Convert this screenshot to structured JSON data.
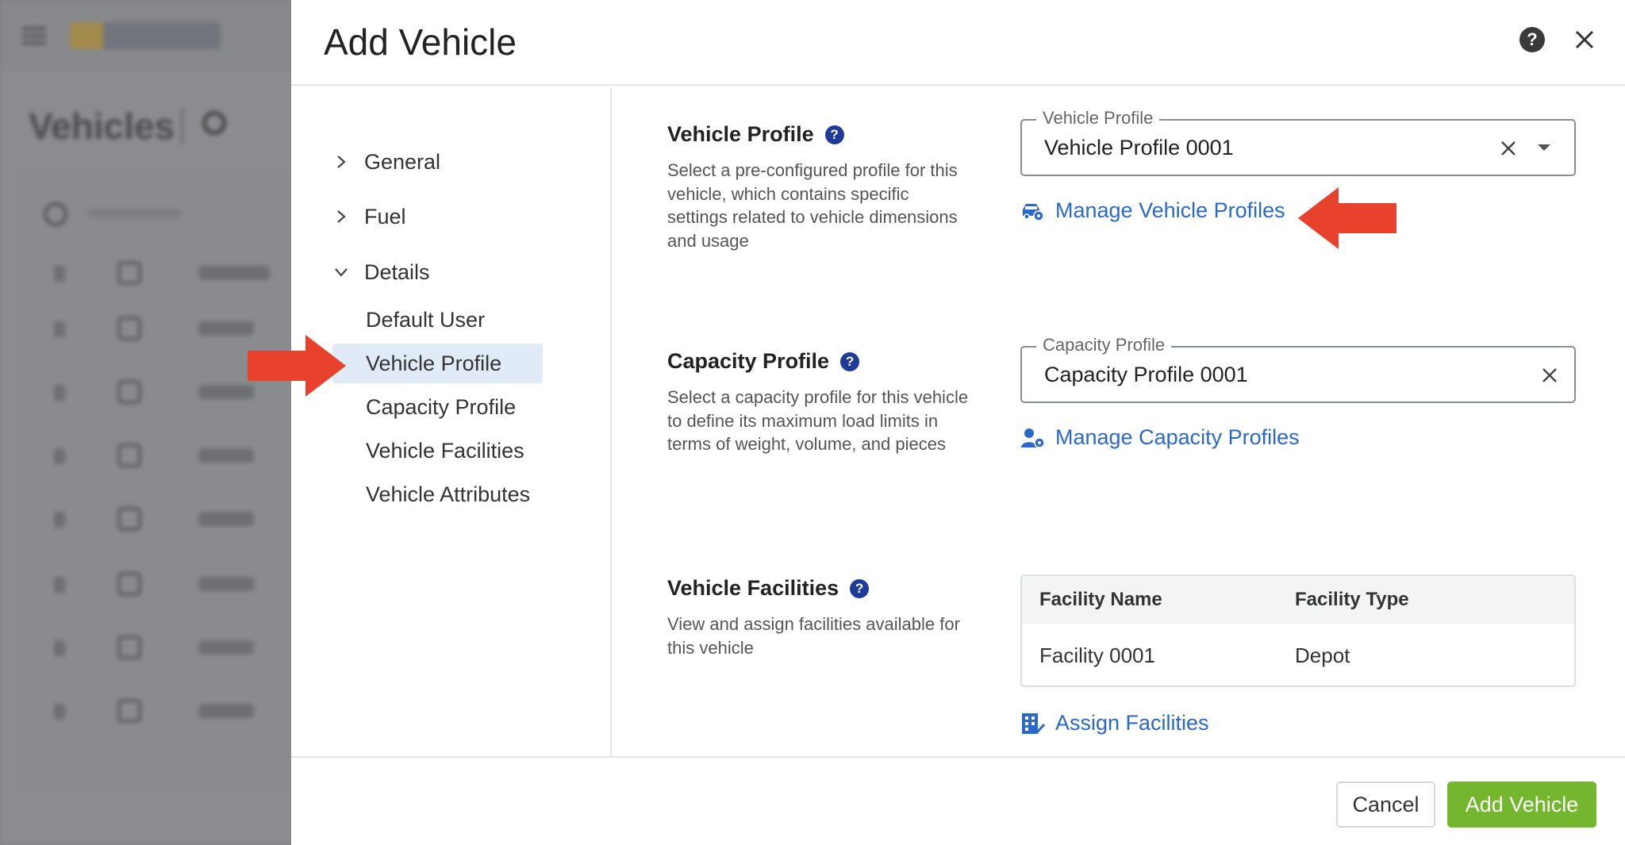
{
  "background": {
    "title": "Vehicles"
  },
  "dialog": {
    "title": "Add Vehicle",
    "help_icon": "?",
    "close_icon": "close-icon"
  },
  "nav": {
    "sections": [
      {
        "label": "General",
        "expanded": false
      },
      {
        "label": "Fuel",
        "expanded": false
      },
      {
        "label": "Details",
        "expanded": true
      }
    ],
    "items": [
      {
        "label": "Default User",
        "active": false
      },
      {
        "label": "Vehicle Profile",
        "active": true
      },
      {
        "label": "Capacity Profile",
        "active": false
      },
      {
        "label": "Vehicle Facilities",
        "active": false
      },
      {
        "label": "Vehicle Attributes",
        "active": false
      }
    ]
  },
  "vehicle_profile": {
    "title": "Vehicle Profile",
    "description": "Select a pre-configured profile for this vehicle, which contains specific settings related to vehicle dimensions and usage",
    "field_label": "Vehicle Profile",
    "field_value": "Vehicle Profile 0001",
    "link": "Manage Vehicle Profiles"
  },
  "capacity_profile": {
    "title": "Capacity Profile",
    "description": "Select a capacity profile for this vehicle to define its maximum load limits in terms of weight, volume, and pieces",
    "field_label": "Capacity Profile",
    "field_value": "Capacity Profile 0001",
    "link": "Manage Capacity Profiles"
  },
  "vehicle_facilities": {
    "title": "Vehicle Facilities",
    "description": "View and assign facilities available for this vehicle",
    "columns": [
      "Facility Name",
      "Facility Type"
    ],
    "rows": [
      [
        "Facility 0001",
        "Depot"
      ]
    ],
    "link": "Assign Facilities"
  },
  "footer": {
    "cancel": "Cancel",
    "submit": "Add Vehicle"
  },
  "colors": {
    "accent_link": "#2a69c9",
    "primary_button": "#74b72e",
    "active_nav": "#e1ebf8",
    "arrow": "#e8412c",
    "help_badge": "#1e3b9a"
  }
}
